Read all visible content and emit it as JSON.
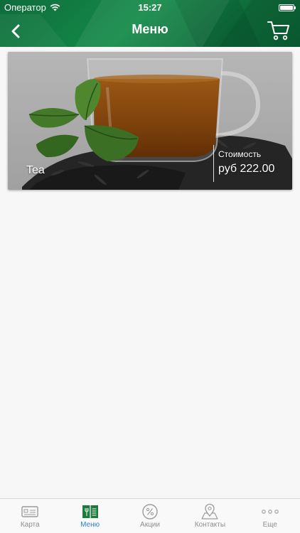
{
  "status_bar": {
    "carrier": "Оператор",
    "time": "15:27",
    "battery_level": 1.0
  },
  "nav": {
    "title": "Меню",
    "back_icon": "chevron-left-icon",
    "cart_icon": "cart-icon"
  },
  "menu_items": [
    {
      "name": "Tea",
      "price_label": "Стоимость",
      "price": "руб 222.00",
      "image": "tea-cup-photo"
    }
  ],
  "tabs": [
    {
      "label": "Карта",
      "icon": "card-icon",
      "active": false
    },
    {
      "label": "Меню",
      "icon": "menu-icon",
      "active": true
    },
    {
      "label": "Акции",
      "icon": "percent-icon",
      "active": false
    },
    {
      "label": "Контакты",
      "icon": "map-pin-icon",
      "active": false
    },
    {
      "label": "Еще",
      "icon": "more-icon",
      "active": false
    }
  ],
  "colors": {
    "header_green": "#138a47",
    "tab_active": "#2a7fd4",
    "tab_inactive": "#8e8e8e",
    "menu_tab_icon": "#1c7a3d",
    "background": "#f7f7f7"
  }
}
